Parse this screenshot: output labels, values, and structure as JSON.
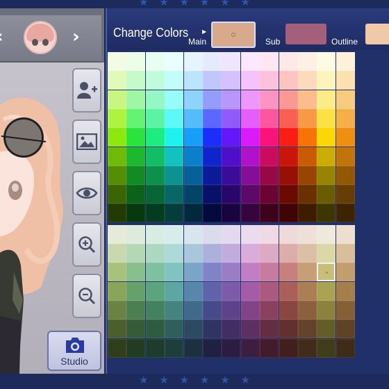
{
  "header": {
    "title": "Change Colors",
    "swatches": [
      {
        "label": "Main",
        "color": "#d8a98b"
      },
      {
        "label": "Sub",
        "color": "#a45f7a"
      },
      {
        "label": "Outline",
        "color": "#f0c9a8"
      }
    ]
  },
  "sidebar": {
    "studio_label": "Studio",
    "tools": [
      "add-character-icon",
      "background-image-icon",
      "eye-icon",
      "zoom-in-icon",
      "zoom-out-icon"
    ]
  },
  "palette": {
    "selected": {
      "row": 11,
      "col": 11
    },
    "bright_rows": [
      [
        "#f4fbe4",
        "#ecfde8",
        "#e8fef0",
        "#e9fefe",
        "#e6f4fe",
        "#e7eafe",
        "#efe6fe",
        "#fbe8fe",
        "#fee6f2",
        "#fee8e8",
        "#fef0e5",
        "#fefbe5",
        "#fef2d8"
      ],
      [
        "#e1f9b9",
        "#c6fac9",
        "#c0fbdc",
        "#c2fcfb",
        "#bde4fd",
        "#c1c6fd",
        "#d5c1fd",
        "#f5c2fd",
        "#fdc1de",
        "#fdc4c2",
        "#fdd9bd",
        "#fdf4bd",
        "#fbe1b0"
      ],
      [
        "#c9f682",
        "#9df7a4",
        "#95f8c4",
        "#98faf9",
        "#8ed3fc",
        "#939dfc",
        "#b896fc",
        "#ee97fb",
        "#fb93c4",
        "#fb9893",
        "#fbbd8b",
        "#fbec89",
        "#f8cc7e"
      ],
      [
        "#aef33d",
        "#64f372",
        "#5af5a3",
        "#5ef8f6",
        "#55bcfb",
        "#5a68fb",
        "#915bfb",
        "#e55dfa",
        "#fa57a0",
        "#fa5f56",
        "#fa9846",
        "#fbe244",
        "#f4b047"
      ],
      [
        "#8de80b",
        "#2ae43e",
        "#1ded7c",
        "#1df2ef",
        "#169efa",
        "#1a2ffa",
        "#6418f9",
        "#d91bf8",
        "#f81479",
        "#f81f12",
        "#f87207",
        "#fad705",
        "#ee8f12"
      ],
      [
        "#6fbb08",
        "#1bb830",
        "#12be63",
        "#12c2c0",
        "#0c7fcb",
        "#1024cb",
        "#4f0fca",
        "#af12c8",
        "#c90c60",
        "#c9150a",
        "#c95b04",
        "#cbad04",
        "#c27409"
      ],
      [
        "#548e06",
        "#138b24",
        "#0c904b",
        "#0c9391",
        "#076099",
        "#0b1a99",
        "#3c0b99",
        "#840e97",
        "#980748",
        "#980f06",
        "#984503",
        "#998303",
        "#935806"
      ],
      [
        "#3b6404",
        "#0c6218",
        "#086535",
        "#086766",
        "#044469",
        "#071169",
        "#29076a",
        "#5c0969",
        "#6a0432",
        "#6a0a03",
        "#6a3002",
        "#6a5c02",
        "#663d04"
      ],
      [
        "#233b02",
        "#063a0e",
        "#043c1f",
        "#043d3c",
        "#02283e",
        "#030a3e",
        "#18043e",
        "#36053e",
        "#3e021d",
        "#3e0502",
        "#3e1c01",
        "#3e3601",
        "#3c2402"
      ]
    ],
    "muted_rows": [
      [
        "#e5ead9",
        "#dcebdc",
        "#d9ece2",
        "#d9ecec",
        "#d9e5ee",
        "#dadcee",
        "#e2daee",
        "#ecdaee",
        "#eed9e5",
        "#eedada",
        "#eee0d8",
        "#eeeadb",
        "#ecdfd0"
      ],
      [
        "#c9d8ad",
        "#b4d7b4",
        "#acd8c2",
        "#addad8",
        "#a9c7dc",
        "#aeb0dc",
        "#c1acdc",
        "#d8addb",
        "#dcaac3",
        "#dcaeaa",
        "#dcc0a6",
        "#dcd7a6",
        "#d8bf9b"
      ],
      [
        "#a9c27b",
        "#88bf8d",
        "#7ec1a0",
        "#80c3c1",
        "#7ba5c7",
        "#8084c7",
        "#9b7dc7",
        "#c17ec5",
        "#c77ba0",
        "#c7807b",
        "#c79e76",
        "#c7bf76",
        "#c29e6d"
      ],
      [
        "#88a55a",
        "#66a16b",
        "#5ca47e",
        "#5ea6a3",
        "#5987ab",
        "#5e63ab",
        "#7d5bab",
        "#a45ca9",
        "#ab597f",
        "#ab5f59",
        "#ab7e54",
        "#aba354",
        "#a57e4c"
      ],
      [
        "#6a8242",
        "#4b7f50",
        "#43815f",
        "#458380",
        "#41698a",
        "#454a8a",
        "#5e438a",
        "#824388",
        "#8a4160",
        "#8a4641",
        "#8a603d",
        "#8a823d",
        "#856037"
      ],
      [
        "#4b5e2e",
        "#355b38",
        "#2e5c43",
        "#305e5b",
        "#2d4a63",
        "#303463",
        "#422e63",
        "#5d2f62",
        "#632d44",
        "#63312d",
        "#63432a",
        "#635d2a",
        "#5f4326"
      ],
      [
        "#303e1c",
        "#223c24",
        "#1d3c2b",
        "#1e3e3c",
        "#1c3041",
        "#1e2141",
        "#2a1d41",
        "#3d1e40",
        "#411c2c",
        "#411f1c",
        "#412b1a",
        "#413d1a",
        "#3e2b18"
      ]
    ]
  }
}
